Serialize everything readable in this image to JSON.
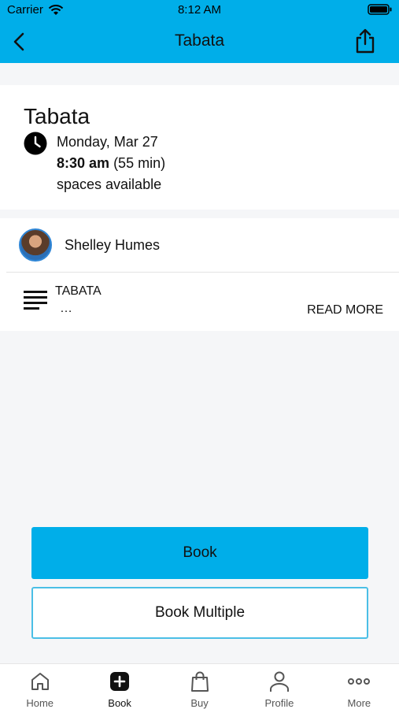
{
  "status_bar": {
    "carrier": "Carrier",
    "time": "8:12 AM"
  },
  "nav": {
    "title": "Tabata",
    "back_icon": "chevron-left-icon",
    "share_icon": "share-icon"
  },
  "class_info": {
    "name": "Tabata",
    "date": "Monday, Mar 27",
    "start_time": "8:30 am",
    "duration": "(55 min)",
    "availability": "spaces available"
  },
  "instructor": {
    "name": "Shelley Humes"
  },
  "description": {
    "title": "TABATA",
    "preview": "…",
    "read_more": "READ MORE"
  },
  "actions": {
    "book": "Book",
    "book_multiple": "Book Multiple"
  },
  "tabs": [
    {
      "label": "Home",
      "icon": "home-icon"
    },
    {
      "label": "Book",
      "icon": "plus-square-icon"
    },
    {
      "label": "Buy",
      "icon": "shopping-bag-icon"
    },
    {
      "label": "Profile",
      "icon": "person-icon"
    },
    {
      "label": "More",
      "icon": "more-dots-icon"
    }
  ],
  "colors": {
    "accent": "#00aee9",
    "background": "#f5f6f8",
    "card": "#ffffff"
  }
}
